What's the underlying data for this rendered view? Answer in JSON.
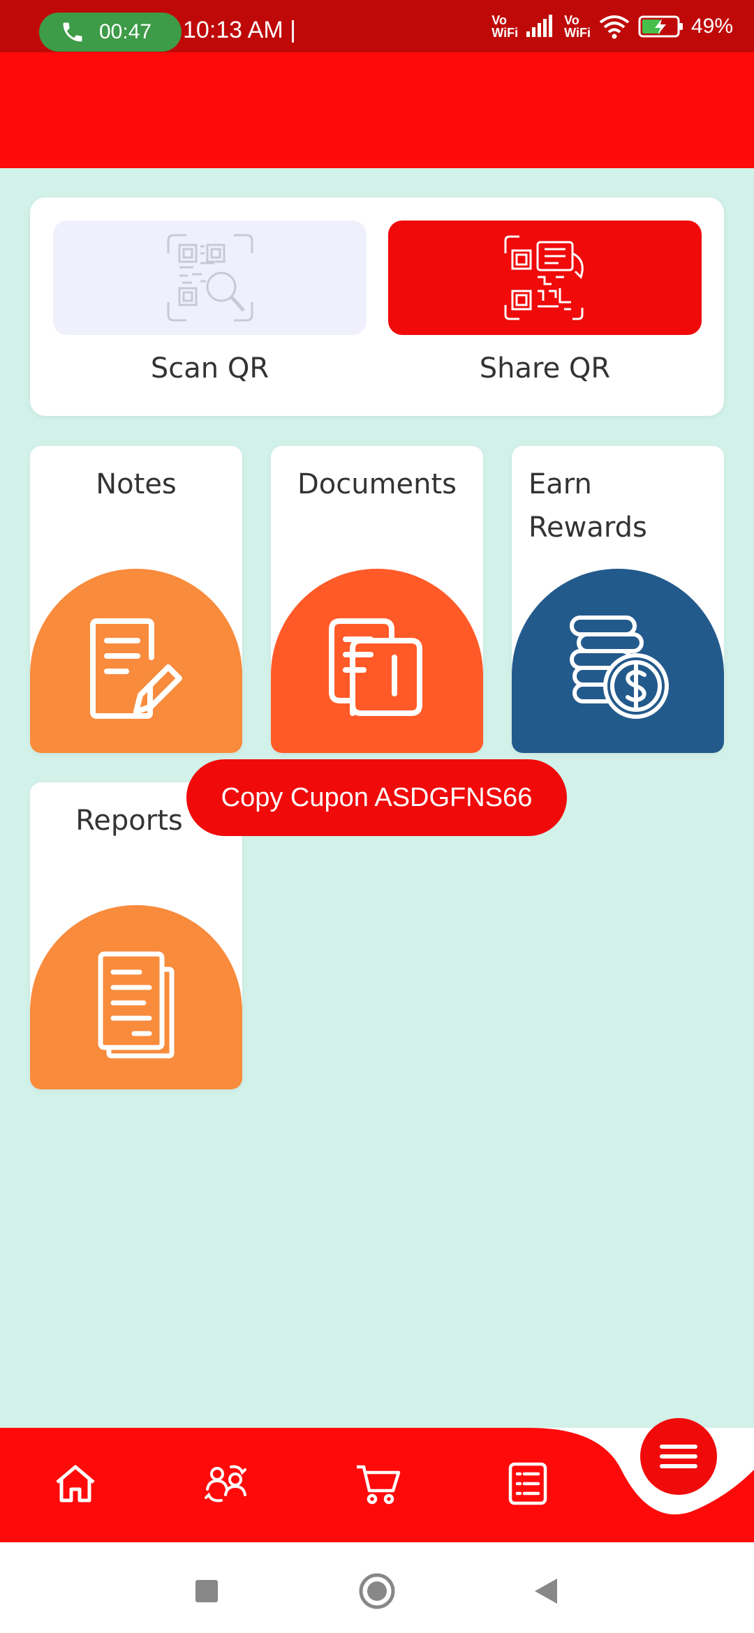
{
  "status_bar": {
    "call_timer": "00:47",
    "time": "10:13 AM |",
    "vowifi_1_top": "Vo",
    "vowifi_1_bottom": "WiFi",
    "vowifi_2_top": "Vo",
    "vowifi_2_bottom": "WiFi",
    "battery": "49%"
  },
  "qr": {
    "scan_label": "Scan QR",
    "share_label": "Share QR"
  },
  "tiles": {
    "notes": "Notes",
    "documents": "Documents",
    "earn_rewards": "Earn\nRewards",
    "reports": "Reports"
  },
  "toast": {
    "text": "Copy Cupon ASDGFNS66"
  },
  "colors": {
    "header_red": "#ff0a0a",
    "status_red": "#bf0909",
    "background": "#d2f1e9",
    "orange": "#f88b3c",
    "deep_orange": "#ff5a28",
    "blue": "#235a8c"
  },
  "bottom_nav": {
    "items": [
      "home-icon",
      "users-exchange-icon",
      "cart-icon",
      "list-icon"
    ],
    "fab_icon": "menu-icon"
  }
}
